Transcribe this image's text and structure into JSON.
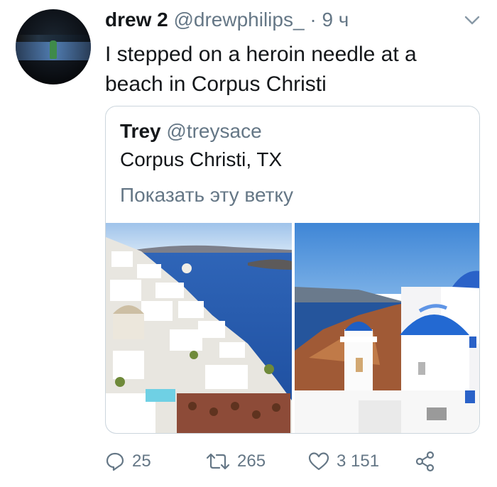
{
  "tweet": {
    "display_name": "drew 2",
    "handle": "@drewphilips_",
    "separator": "·",
    "time": "9 ч",
    "text": "I stepped on a heroin needle at a beach in Corpus Christi",
    "avatar_icon": "avatar-photo"
  },
  "quoted": {
    "display_name": "Trey",
    "handle": "@treysace",
    "text": "Corpus Christi, TX",
    "show_thread": "Показать эту ветку",
    "images": [
      "santorini-white-buildings",
      "santorini-blue-domes"
    ]
  },
  "actions": {
    "replies": "25",
    "retweets": "265",
    "likes": "3 151",
    "icons": [
      "reply-icon",
      "retweet-icon",
      "like-icon",
      "share-icon"
    ]
  },
  "colors": {
    "text": "#14171a",
    "secondary": "#657786",
    "border": "#ccd6dd",
    "sea": "#1f57b5",
    "sky": "#4a8ed8"
  }
}
